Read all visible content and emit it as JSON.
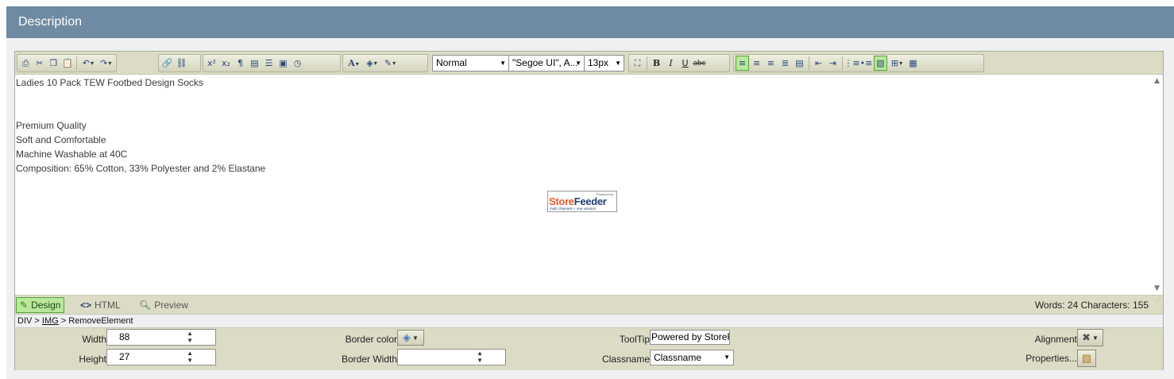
{
  "panel": {
    "title": "Description"
  },
  "toolbar": {
    "format_select": "Normal",
    "font_select": "\"Segoe UI\", A...",
    "size_select": "13px"
  },
  "content": {
    "lines": [
      "Ladies 10 Pack TEW Footbed Design Socks",
      "Premium Quality",
      "Soft and Comfortable",
      "Machine Washable at 40C",
      "Composition: 65% Cotton, 33% Polyester and 2% Elastane"
    ],
    "logo": {
      "powered": "Powered by",
      "brand_store": "Store",
      "brand_feeder": "Feeder",
      "tagline": "multi channels + one solution"
    }
  },
  "modes": {
    "design": "Design",
    "html": "HTML",
    "preview": "Preview"
  },
  "stats": {
    "text": "Words: 24   Characters: 155"
  },
  "path": {
    "div": "DIV",
    "sep": ">",
    "img": "IMG",
    "remove": "RemoveElement"
  },
  "properties": {
    "width_label": "Width",
    "width_value": "88",
    "height_label": "Height",
    "height_value": "27",
    "border_color_label": "Border color",
    "border_width_label": "Border Width",
    "border_width_value": "",
    "tooltip_label": "ToolTip",
    "tooltip_value": "Powered by StoreF",
    "classname_label": "Classname",
    "classname_value": "Classname",
    "alignment_label": "Alignment",
    "properties_label": "Properties..."
  },
  "colors": {
    "header": "#6f8aa3",
    "toolbar": "#dcdcc6",
    "active_green": "#b9e79c"
  }
}
